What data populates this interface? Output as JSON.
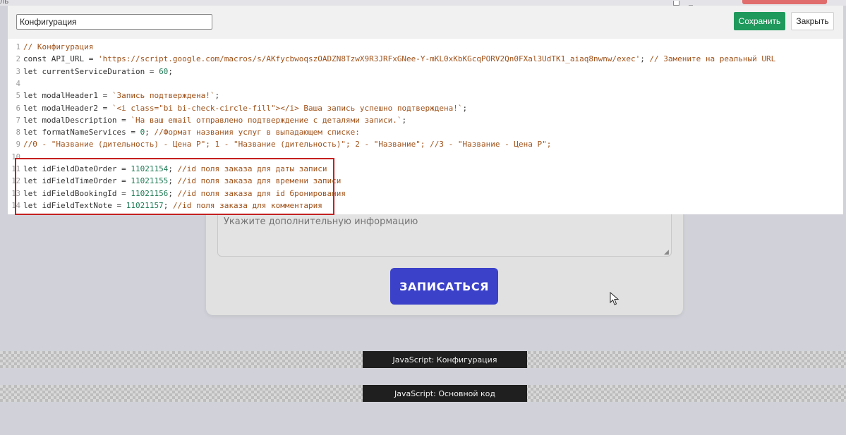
{
  "background": {
    "top_strip_left_text": "ль",
    "comment_placeholder": "Укажите дополнительную информацию",
    "submit_label": "ЗАПИСАТЬСЯ",
    "blocks": [
      {
        "label": "JavaScript: Конфигурация"
      },
      {
        "label": "JavaScript: Основной код"
      }
    ]
  },
  "modal": {
    "title_value": "Конфигурация",
    "save_label": "Сохранить",
    "close_label": "Закрыть",
    "code_lines": [
      {
        "n": "1",
        "parts": [
          [
            "cmt",
            "// Конфигурация"
          ]
        ]
      },
      {
        "n": "2",
        "parts": [
          [
            "kw",
            "const API_URL = "
          ],
          [
            "str",
            "'https://script.google.com/macros/s/AKfycbwoqszOADZN8TzwX9R3JRFxGNee-Y-mKL0xKbKGcqPORV2Qn0FXal3UdTK1_aiaq8nwnw/exec'"
          ],
          [
            "kw",
            "; "
          ],
          [
            "cmt",
            "// Замените на реальный URL"
          ]
        ]
      },
      {
        "n": "3",
        "parts": [
          [
            "kw",
            "let currentServiceDuration = "
          ],
          [
            "num",
            "60"
          ],
          [
            "kw",
            ";"
          ]
        ]
      },
      {
        "n": "4",
        "parts": []
      },
      {
        "n": "5",
        "parts": [
          [
            "kw",
            "let modalHeader1 = "
          ],
          [
            "str",
            "`Запись подтверждена!`"
          ],
          [
            "kw",
            ";"
          ]
        ]
      },
      {
        "n": "6",
        "parts": [
          [
            "kw",
            "let modalHeader2 = "
          ],
          [
            "str",
            "`<i class=\"bi bi-check-circle-fill\"></i> Ваша запись успешно подтверждена!`"
          ],
          [
            "kw",
            ";"
          ]
        ]
      },
      {
        "n": "7",
        "parts": [
          [
            "kw",
            "let modalDescription = "
          ],
          [
            "str",
            "`На ваш email отправлено подтверждение с деталями записи.`"
          ],
          [
            "kw",
            ";"
          ]
        ]
      },
      {
        "n": "8",
        "parts": [
          [
            "kw",
            "let formatNameServices = "
          ],
          [
            "num",
            "0"
          ],
          [
            "kw",
            "; "
          ],
          [
            "cmt",
            "//Формат названия услуг в выпадающем списке:"
          ]
        ]
      },
      {
        "n": "9",
        "parts": [
          [
            "cmt",
            "//0 - \"Название (дительность) - Цена Р\"; 1 - \"Название (дительность)\"; 2 - \"Название\"; //3 - \"Название - Цена Р\";"
          ]
        ]
      },
      {
        "n": "10",
        "parts": []
      },
      {
        "n": "11",
        "parts": [
          [
            "kw",
            "let idFieldDateOrder = "
          ],
          [
            "num",
            "11021154"
          ],
          [
            "kw",
            "; "
          ],
          [
            "cmt",
            "//id поля заказа для даты записи"
          ]
        ]
      },
      {
        "n": "12",
        "parts": [
          [
            "kw",
            "let idFieldTimeOrder = "
          ],
          [
            "num",
            "11021155"
          ],
          [
            "kw",
            "; "
          ],
          [
            "cmt",
            "//id поля заказа для времени записи"
          ]
        ]
      },
      {
        "n": "13",
        "parts": [
          [
            "kw",
            "let idFieldBookingId = "
          ],
          [
            "num",
            "11021156"
          ],
          [
            "kw",
            "; "
          ],
          [
            "cmt",
            "//id поля заказа для id бронирования"
          ]
        ]
      },
      {
        "n": "14",
        "parts": [
          [
            "kw",
            "let idFieldTextNote = "
          ],
          [
            "num",
            "11021157"
          ],
          [
            "kw",
            "; "
          ],
          [
            "cmt",
            "//id поля заказа для комментария"
          ]
        ]
      }
    ]
  },
  "colors": {
    "save_button": "#1f9a5c",
    "submit_button": "#3b41c9",
    "highlight_border": "#c42020",
    "string_color": "#a0521a",
    "number_color": "#1b7a53"
  }
}
